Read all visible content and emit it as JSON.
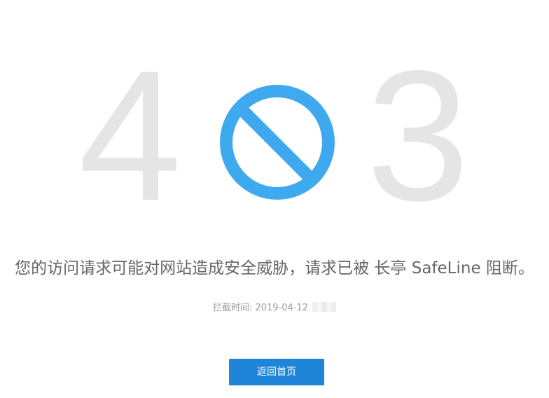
{
  "error": {
    "digit_left": "4",
    "digit_right": "3",
    "icon": "block-icon",
    "icon_color": "#3fa9f0",
    "digit_color": "#e5e5e5"
  },
  "message": "您的访问请求可能对网站造成安全威胁，请求已被 长亭 SafeLine 阻断。",
  "meta": {
    "label": "拦截时间: 2019-04-12"
  },
  "actions": {
    "home_button_label": "返回首页",
    "button_color": "#1e85d8"
  }
}
